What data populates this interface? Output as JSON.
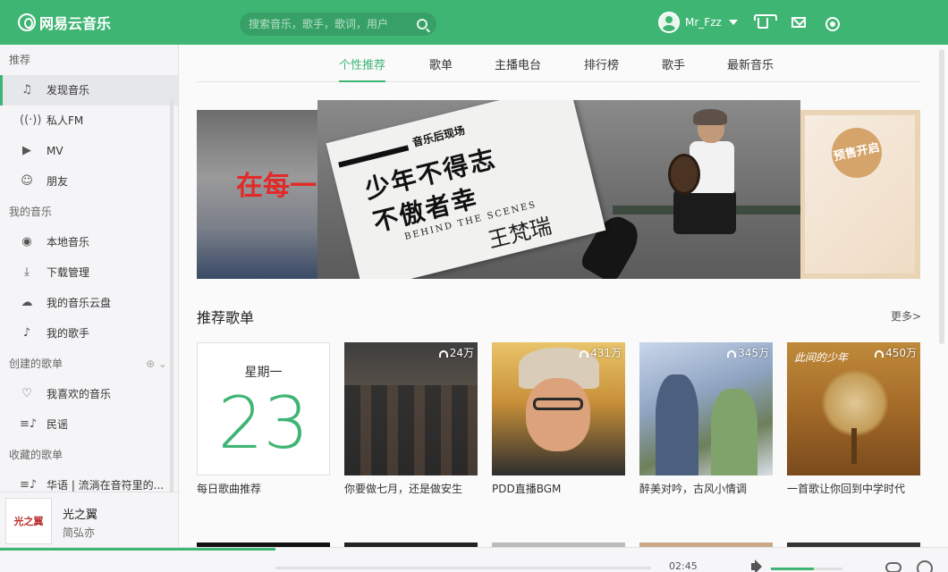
{
  "app": {
    "logo_text": "网易云音乐",
    "search_placeholder": "搜索音乐，歌手，歌词，用户",
    "username": "Mr_Fzz"
  },
  "colors": {
    "accent": "#3fb574",
    "topbar": "#3fb574",
    "sidebar_bg": "#f5f5f7"
  },
  "sidebar": {
    "sections": [
      {
        "title": "推荐",
        "items": [
          {
            "label": "发现音乐",
            "icon": "music-note-icon",
            "active": true
          },
          {
            "label": "私人FM",
            "icon": "radio-icon"
          },
          {
            "label": "MV",
            "icon": "video-icon"
          },
          {
            "label": "朋友",
            "icon": "friends-icon"
          }
        ]
      },
      {
        "title": "我的音乐",
        "items": [
          {
            "label": "本地音乐",
            "icon": "disc-icon"
          },
          {
            "label": "下载管理",
            "icon": "download-icon"
          },
          {
            "label": "我的音乐云盘",
            "icon": "cloud-icon"
          },
          {
            "label": "我的歌手",
            "icon": "singer-icon"
          }
        ]
      },
      {
        "title": "创建的歌单",
        "items": [
          {
            "label": "我喜欢的音乐",
            "icon": "heart-icon"
          },
          {
            "label": "民谣",
            "icon": "playlist-icon"
          }
        ]
      },
      {
        "title": "收藏的歌单",
        "items": [
          {
            "label": "华语 | 流淌在音符里的...",
            "icon": "playlist-icon"
          }
        ]
      }
    ]
  },
  "now_playing": {
    "cover_text": "光之翼",
    "title": "光之翼",
    "artist": "简弘亦",
    "time": "02:45",
    "progress": 0.29,
    "volume": 0.6
  },
  "tabs": [
    "个性推荐",
    "歌单",
    "主播电台",
    "排行榜",
    "歌手",
    "最新音乐"
  ],
  "active_tab": "个性推荐",
  "banner": {
    "left_text": "在每一",
    "tag": "音乐后现场",
    "headline_1": "少年不得志",
    "headline_2": "不傲者幸",
    "subtitle": "BEHIND THE SCENES",
    "signature": "王梵瑞",
    "right_badge": "预售开启"
  },
  "recommend": {
    "title": "推荐歌单",
    "more_label": "更多>",
    "daily": {
      "week": "星期一",
      "day": "23",
      "name": "每日歌曲推荐"
    },
    "playlists": [
      {
        "name": "你要做七月，还是做安生",
        "plays": "24万"
      },
      {
        "name": "PDD直播BGM",
        "plays": "431万"
      },
      {
        "name": "醉美对吟，古风小情调",
        "plays": "345万"
      },
      {
        "name": "一首歌让你回到中学时代",
        "plays": "450万",
        "cover_title": "此间的少年"
      }
    ]
  }
}
